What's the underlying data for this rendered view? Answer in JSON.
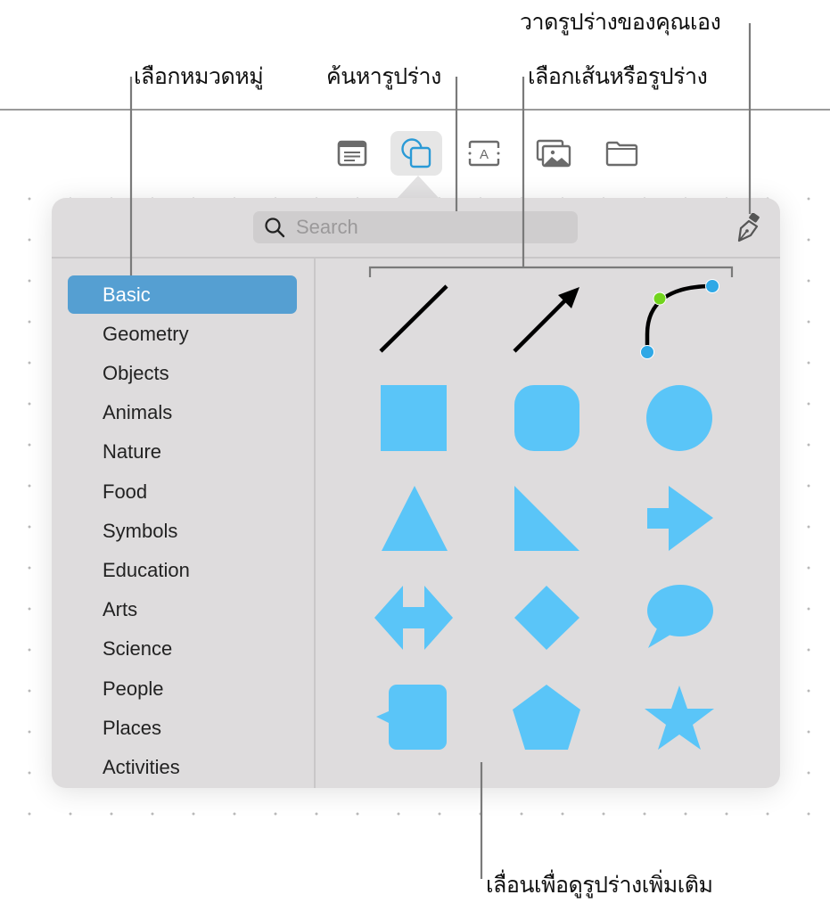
{
  "callouts": {
    "draw_own": "วาดรูปร่างของคุณเอง",
    "choose_category": "เลือกหมวดหมู่",
    "search_shapes": "ค้นหารูปร่าง",
    "choose_line_or_shape": "เลือกเส้นหรือรูปร่าง",
    "scroll_more": "เลื่อนเพื่อดูรูปร่างเพิ่มเติม"
  },
  "toolbar": {
    "items": [
      {
        "icon": "table-icon"
      },
      {
        "icon": "shapes-icon",
        "selected": true
      },
      {
        "icon": "text-box-icon"
      },
      {
        "icon": "media-icon"
      },
      {
        "icon": "folder-icon"
      }
    ]
  },
  "search": {
    "placeholder": "Search"
  },
  "sidebar": {
    "items": [
      {
        "label": "Basic",
        "selected": true
      },
      {
        "label": "Geometry"
      },
      {
        "label": "Objects"
      },
      {
        "label": "Animals"
      },
      {
        "label": "Nature"
      },
      {
        "label": "Food"
      },
      {
        "label": "Symbols"
      },
      {
        "label": "Education"
      },
      {
        "label": "Arts"
      },
      {
        "label": "Science"
      },
      {
        "label": "People"
      },
      {
        "label": "Places"
      },
      {
        "label": "Activities"
      }
    ]
  },
  "shapes": [
    "line",
    "arrow-line",
    "curve",
    "square",
    "rounded-square",
    "circle",
    "triangle",
    "right-triangle",
    "right-arrow",
    "double-arrow",
    "diamond",
    "speech-bubble",
    "callout-square",
    "pentagon",
    "star"
  ],
  "colors": {
    "accent": "#559fd2",
    "shape_fill": "#5ac5f8",
    "popover_bg": "#dedcdd",
    "selected_icon": "#2a9ad6"
  }
}
